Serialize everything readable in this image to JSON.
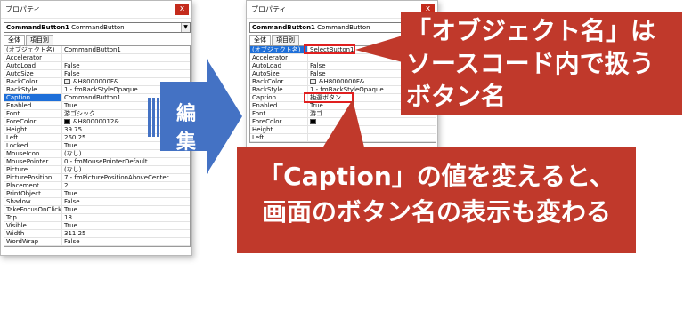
{
  "left_window": {
    "title": "プロパティ",
    "close_label": "x",
    "object_combo": {
      "name": "CommandButton1",
      "type": "CommandButton"
    },
    "tabs": [
      "全体",
      "項目別"
    ],
    "properties": [
      {
        "key": "(オブジェクト名)",
        "value": "CommandButton1"
      },
      {
        "key": "Accelerator",
        "value": ""
      },
      {
        "key": "AutoLoad",
        "value": "False"
      },
      {
        "key": "AutoSize",
        "value": "False"
      },
      {
        "key": "BackColor",
        "value": "&H8000000F&",
        "swatch": "#f0f0f0"
      },
      {
        "key": "BackStyle",
        "value": "1 - fmBackStyleOpaque"
      },
      {
        "key": "Caption",
        "value": "CommandButton1",
        "selected": true
      },
      {
        "key": "Enabled",
        "value": "True"
      },
      {
        "key": "Font",
        "value": "游ゴシック"
      },
      {
        "key": "ForeColor",
        "value": "&H80000012&",
        "swatch": "#000000"
      },
      {
        "key": "Height",
        "value": "39.75"
      },
      {
        "key": "Left",
        "value": "260.25"
      },
      {
        "key": "Locked",
        "value": "True"
      },
      {
        "key": "MouseIcon",
        "value": "(なし)"
      },
      {
        "key": "MousePointer",
        "value": "0 - fmMousePointerDefault"
      },
      {
        "key": "Picture",
        "value": "(なし)"
      },
      {
        "key": "PicturePosition",
        "value": "7 - fmPicturePositionAboveCenter"
      },
      {
        "key": "Placement",
        "value": "2"
      },
      {
        "key": "PrintObject",
        "value": "True"
      },
      {
        "key": "Shadow",
        "value": "False"
      },
      {
        "key": "TakeFocusOnClick",
        "value": "True"
      },
      {
        "key": "Top",
        "value": "18"
      },
      {
        "key": "Visible",
        "value": "True"
      },
      {
        "key": "Width",
        "value": "311.25"
      },
      {
        "key": "WordWrap",
        "value": "False"
      }
    ]
  },
  "right_window": {
    "title": "プロパティ",
    "close_label": "x",
    "object_combo": {
      "name": "CommandButton1",
      "type": "CommandButton"
    },
    "tabs": [
      "全体",
      "項目別"
    ],
    "properties": [
      {
        "key": "(オブジェクト名)",
        "value": "SelectButton1",
        "selected": true
      },
      {
        "key": "Accelerator",
        "value": ""
      },
      {
        "key": "AutoLoad",
        "value": "False"
      },
      {
        "key": "AutoSize",
        "value": "False"
      },
      {
        "key": "BackColor",
        "value": "&H8000000F&",
        "swatch": "#f0f0f0"
      },
      {
        "key": "BackStyle",
        "value": "1 - fmBackStyleOpaque"
      },
      {
        "key": "Caption",
        "value": "抽選ボタン"
      },
      {
        "key": "Enabled",
        "value": "True"
      },
      {
        "key": "Font",
        "value": "游ゴ"
      },
      {
        "key": "ForeColor",
        "value": "",
        "swatch": "#000000"
      },
      {
        "key": "Height",
        "value": ""
      },
      {
        "key": "Left",
        "value": ""
      }
    ]
  },
  "arrow": {
    "label_1": "編",
    "label_2": "集",
    "color": "#4472c4"
  },
  "callouts": {
    "top_line1": "「オブジェクト名」は",
    "top_line2": "ソースコード内で扱う",
    "top_line3": "ボタン名",
    "bottom_line1": "「Caption」の値を変えると、",
    "bottom_line2": "画面のボタン名の表示も変わる",
    "color": "#c0392b"
  }
}
